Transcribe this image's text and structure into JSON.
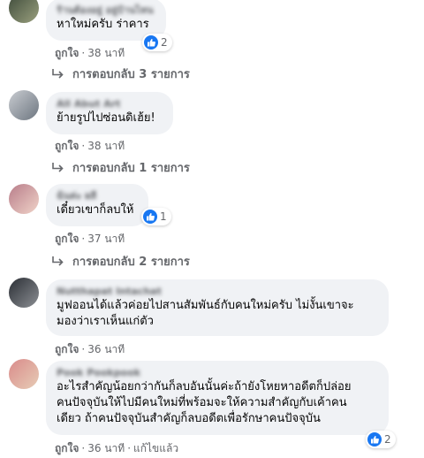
{
  "comments": [
    {
      "author": "ร้านต้องอยู่ อยู่บ้านไหน",
      "text": "หาใหม่ครับ ร่าคาร",
      "reaction_icon": "like-icon",
      "reaction_count": "2",
      "like_label": "ถูกใจ",
      "time": "38 นาที",
      "replies_label": "การตอบกลับ 3 รายการ"
    },
    {
      "author": "All Abut Art",
      "text": "ย้ายรูปไปซ่อนดิเฮ้ย!",
      "like_label": "ถูกใจ",
      "time": "38 นาที",
      "replies_label": "การตอบกลับ 1 รายการ"
    },
    {
      "author": "ฉันค่ะ ผลี",
      "text": "เดี๋ยวเขาก็ลบให้",
      "reaction_icon": "like-icon",
      "reaction_count": "1",
      "like_label": "ถูกใจ",
      "time": "37 นาที",
      "replies_label": "การตอบกลับ 2 รายการ"
    },
    {
      "author": "Nutthapat Intachat",
      "text_lines": [
        "มูฟออนได้แล้วค่อยไปสานสัมพันธ์กับคนใหม่ครับ ไม่งั้นเขาจะ",
        "มองว่าเราเห็นแก่ตัว"
      ],
      "like_label": "ถูกใจ",
      "time": "36 นาที"
    },
    {
      "author": "Pook Pookpook",
      "text_lines": [
        "อะไรสำคัญน้อยกว่ากันก็ลบอันนั้นค่ะถ้ายังโหยหาอดีตก็ปล่อย",
        "คนปัจจุบันให้ไปมีคนใหม่ที่พร้อมจะให้ความสำคัญกับเค้าคน",
        "เดียว ถ้าคนปัจจุบันสำคัญก็ลบอดีตเพื่อรักษาคนปัจจุบัน"
      ],
      "reaction_icon": "like-icon",
      "reaction_count": "2",
      "like_label": "ถูกใจ",
      "time": "36 นาที",
      "edited_label": "แก้ไขแล้ว"
    }
  ],
  "colors": {
    "bubble": "#f0f2f5",
    "secondary_text": "#65676b",
    "like_blue": "#1877f2"
  }
}
